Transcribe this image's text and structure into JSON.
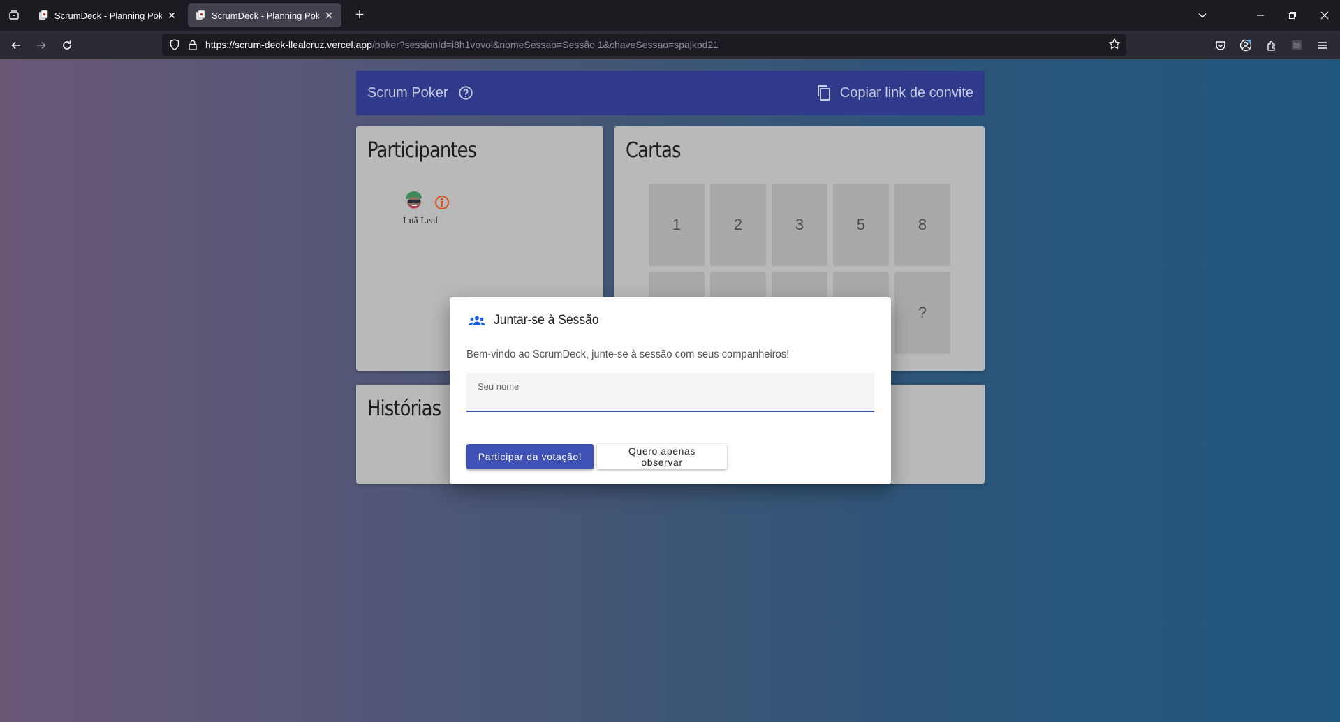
{
  "browser": {
    "tabs": [
      {
        "title": "ScrumDeck - Planning Poker para",
        "active": false
      },
      {
        "title": "ScrumDeck - Planning Poker para",
        "active": true
      }
    ],
    "url_host": "https://scrum-deck-llealcruz.vercel.app",
    "url_path": "/poker?sessionId=i8h1vovol&nomeSessao=Sessão 1&chaveSessao=spajkpd21"
  },
  "app": {
    "brand": "Scrum Poker",
    "invite_label": "Copiar link de convite"
  },
  "participants": {
    "title": "Participantes",
    "list": [
      {
        "name": "Luã Leal",
        "role_icon": "observer-icon"
      }
    ]
  },
  "cards": {
    "title": "Cartas",
    "values": [
      "1",
      "2",
      "3",
      "5",
      "8",
      "",
      "",
      "",
      "",
      "?"
    ]
  },
  "stories": {
    "title": "Histórias"
  },
  "modal": {
    "title": "Juntar-se à Sessão",
    "text": "Bem-vindo ao ScrumDeck, junte-se à sessão com seus companheiros!",
    "name_label": "Seu nome",
    "name_value": "",
    "join_button": "Participar da votação!",
    "observe_button": "Quero apenas observar"
  },
  "colors": {
    "appbar": "#2f3b8a",
    "primary": "#3f51b5",
    "card_bg": "#b9b9b9",
    "observer_icon": "#d9531e"
  }
}
